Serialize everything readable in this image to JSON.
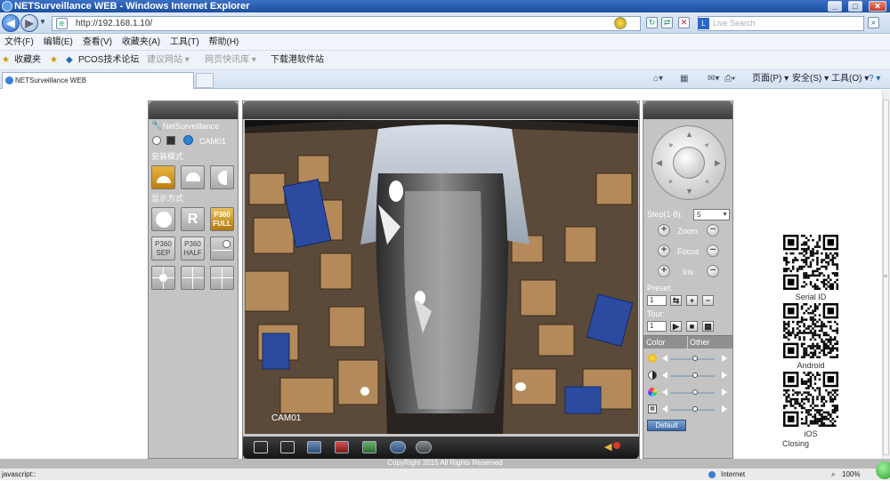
{
  "window": {
    "title": "NETSurveillance WEB - Windows Internet Explorer",
    "min": "_",
    "max": "□",
    "close": "✕"
  },
  "address": {
    "url": "http://192.168.1.10/",
    "search_placeholder": "Live Search"
  },
  "menu": [
    "文件(F)",
    "编辑(E)",
    "查看(V)",
    "收藏夹(A)",
    "工具(T)",
    "帮助(H)"
  ],
  "favorites": {
    "label": "收藏夹",
    "items": [
      "PCOS技术论坛",
      "建议网站 ▾",
      "网页快讯库 ▾",
      "下载港软件站"
    ]
  },
  "tab": {
    "title": "NETSurveillance WEB"
  },
  "commandbar": {
    "page": "页面(P) ▾",
    "safety": "安全(S) ▾",
    "tools": "工具(O) ▾",
    "help": "? ▾"
  },
  "left_panel": {
    "brand": "NetSurveillance",
    "camera": "CAM01",
    "install_mode_label": "安装模式",
    "display_mode_label": "显示方式",
    "display_btn_p360full": "P360 FULL",
    "display_btn_r": "R",
    "display_btn_p360sep": "P360 SEP",
    "display_btn_p360half": "P360 HALF"
  },
  "video": {
    "channel_label": "CAM01"
  },
  "ptz": {
    "step_label": "Step(1-8):",
    "step_value": "5",
    "zoom": "Zoom",
    "focus": "Focus",
    "iris": "Iris",
    "preset_label": "Preset:",
    "preset_value": "1",
    "tour_label": "Tour:",
    "tour_value": "1",
    "color_tab": "Color",
    "other_tab": "Other",
    "default_btn": "Default"
  },
  "qr": {
    "labels": [
      "Serial ID",
      "Android",
      "iOS"
    ],
    "closing": "Closing"
  },
  "footer": {
    "copyright": "CopyRight 2015 All Rights Reserved"
  },
  "status": {
    "left": "javascript::",
    "zone": "Internet",
    "zoom": "100%"
  }
}
